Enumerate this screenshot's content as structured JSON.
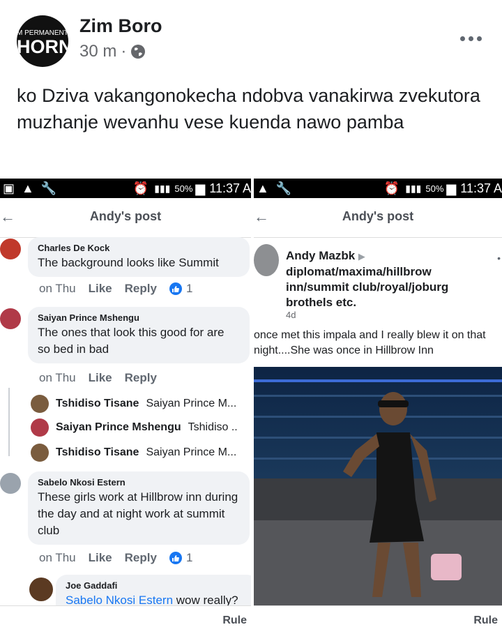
{
  "post": {
    "author": "Zim Boro",
    "time": "30 m",
    "avatar_text_1": "M PERMANENTL",
    "avatar_text_2": "HORNY",
    "caption": "ko Dziva vakangonokecha ndobva vanakirwa zvekutora muzhanje wevanhu vese kuenda nawo pamba"
  },
  "left_screenshot": {
    "status": {
      "battery": "50%",
      "time": "11:37 A"
    },
    "nav_title": "Andy's post",
    "comments": [
      {
        "name": "Charles De Kock",
        "text": "The background looks like Summit",
        "time": "on Thu",
        "like": "Like",
        "reply": "Reply",
        "reactions": "1"
      },
      {
        "name": "Saiyan Prince Mshengu",
        "text": "The ones that look this good for are so bed in bad",
        "time": "on Thu",
        "like": "Like",
        "reply": "Reply"
      },
      {
        "name": "Sabelo Nkosi Estern",
        "text": "These girls work at Hillbrow inn during the day and at night work at summit club",
        "time": "on Thu",
        "like": "Like",
        "reply": "Reply",
        "reactions": "1"
      }
    ],
    "replies": [
      {
        "name": "Tshidiso Tisane",
        "snippet": "Saiyan Prince M..."
      },
      {
        "name": "Saiyan Prince Mshengu",
        "snippet": "Tshidiso .."
      },
      {
        "name": "Tshidiso Tisane",
        "snippet": "Saiyan Prince M..."
      }
    ],
    "nested_reply": {
      "name": "Joe Gaddafi",
      "mention": "Sabelo Nkosi Estern",
      "text": " wow really?"
    },
    "footer": "Rule"
  },
  "right_screenshot": {
    "status": {
      "battery": "50%",
      "time": "11:37 A"
    },
    "nav_title": "Andy's post",
    "post_author": "Andy Mazbk",
    "post_heading": "diplomat/maxima/hillbrow inn/summit club/royal/joburg brothels etc.",
    "post_time": "4d",
    "post_text": "once met this impala and I really blew it on that night....She was once in Hillbrow Inn",
    "footer": "Rule"
  },
  "colors": {
    "accent": "#1877f2",
    "muted": "#65676b",
    "bubble": "#f0f2f5"
  }
}
